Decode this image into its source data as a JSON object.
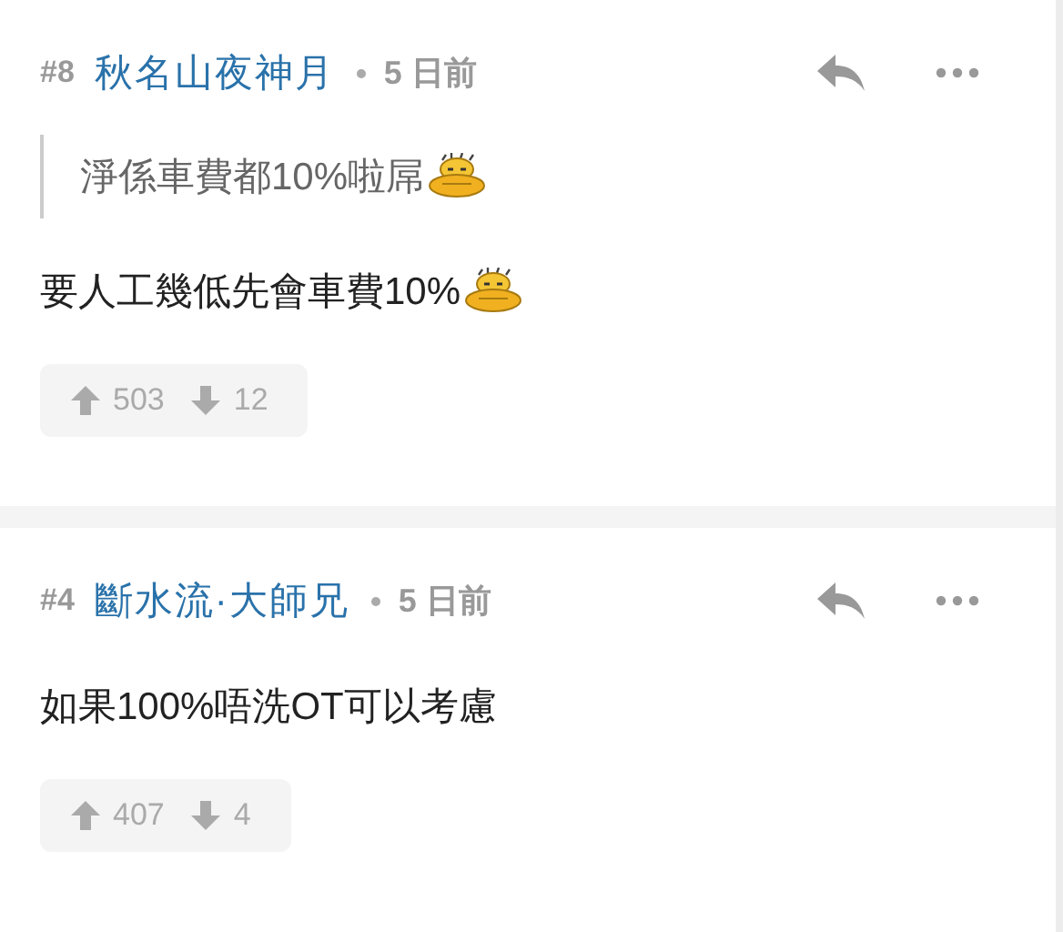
{
  "comments": [
    {
      "number": "#8",
      "author": "秋名山夜神月",
      "time": "5 日前",
      "blocks": [
        {
          "kind": "quote",
          "text": "淨係車費都10%啦屌",
          "emoticon": true
        },
        {
          "kind": "text",
          "text": "要人工幾低先會車費10%",
          "emoticon": true
        }
      ],
      "upvotes": "503",
      "downvotes": "12"
    },
    {
      "number": "#4",
      "author": "斷水流·大師兄",
      "time": "5 日前",
      "blocks": [
        {
          "kind": "text",
          "text": "如果100%唔洗OT可以考慮",
          "emoticon": false
        }
      ],
      "upvotes": "407",
      "downvotes": "4"
    }
  ]
}
